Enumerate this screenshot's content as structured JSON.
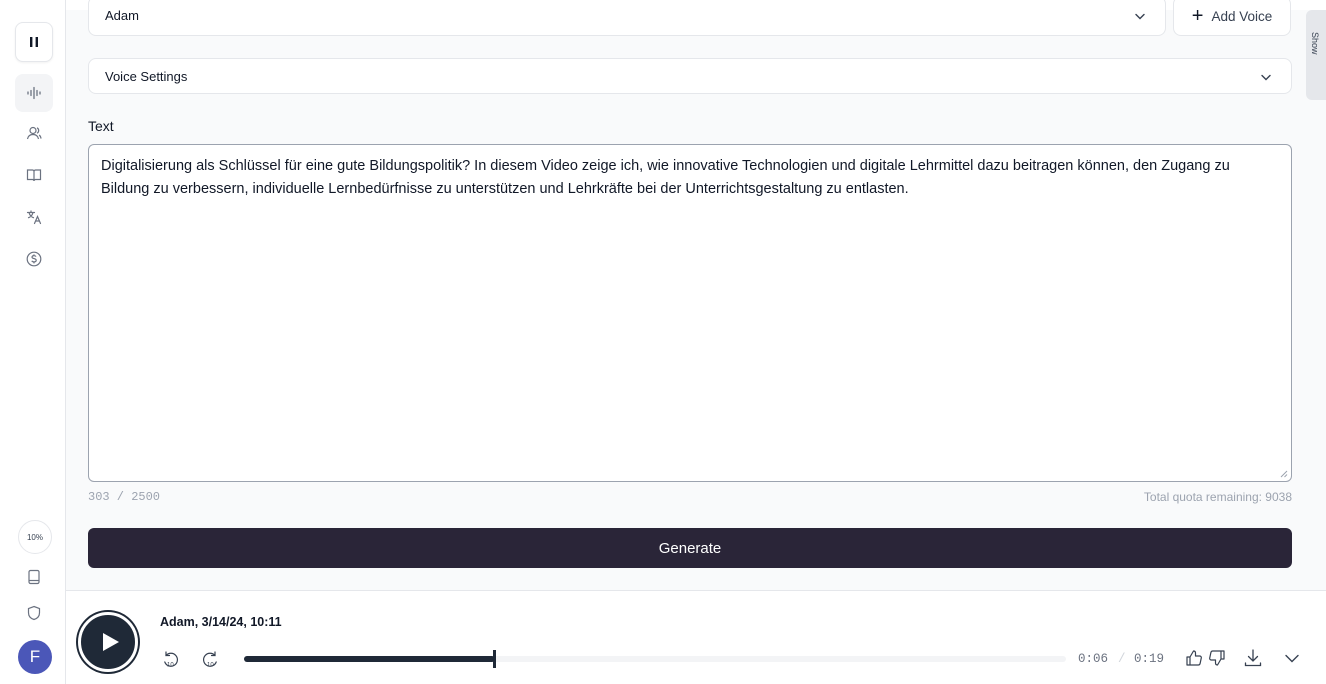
{
  "sidebar": {
    "progress_badge": "10%",
    "avatar_initial": "F"
  },
  "voice": {
    "selected": "Adam",
    "add_voice_label": "Add Voice",
    "show_tab_label": "Show"
  },
  "settings": {
    "label": "Voice Settings"
  },
  "text": {
    "label": "Text",
    "value": "Digitalisierung als Schlüssel für eine gute Bildungspolitik? In diesem Video zeige ich, wie innovative Technologien und digitale Lehrmittel dazu beitragen können, den Zugang zu Bildung zu verbessern, individuelle Lernbedürfnisse zu unterstützen und Lehrkräfte bei der Unterrichtsgestaltung zu entlasten.",
    "counter": "303 / 2500",
    "quota": "Total quota remaining: 9038"
  },
  "generate_label": "Generate",
  "player": {
    "title": "Adam, 3/14/24, 10:11",
    "current_time": "0:06",
    "separator": "/",
    "total_time": "0:19",
    "progress_fraction": 0.305
  },
  "colors": {
    "primary_dark": "#2a2538",
    "avatar": "#4b57b8"
  }
}
